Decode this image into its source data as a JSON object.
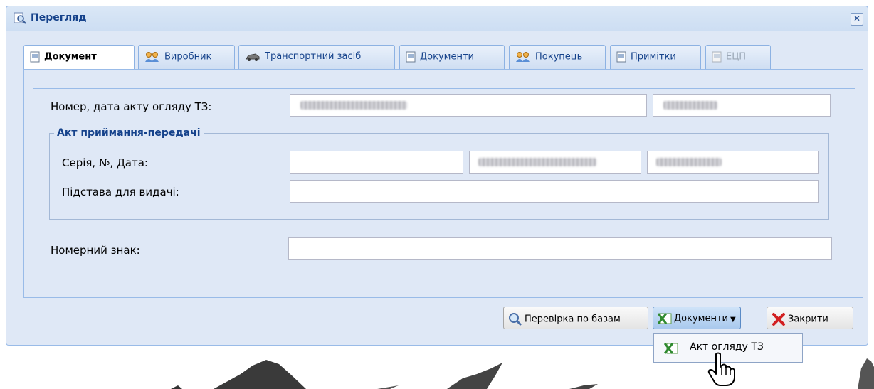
{
  "window": {
    "title": "Перегляд"
  },
  "tabs": [
    {
      "label": "Документ",
      "icon": "document-icon"
    },
    {
      "label": "Виробник",
      "icon": "users-icon"
    },
    {
      "label": "Транспортний засіб",
      "icon": "car-icon"
    },
    {
      "label": "Документи",
      "icon": "document-icon"
    },
    {
      "label": "Покупець",
      "icon": "users-icon"
    },
    {
      "label": "Примітки",
      "icon": "document-icon"
    },
    {
      "label": "ЕЦП",
      "icon": "document-icon"
    }
  ],
  "form": {
    "inspection_label": "Номер, дата акту огляду ТЗ:",
    "group_legend": "Акт приймання-передачі",
    "series_label": "Серія, №, Дата:",
    "basis_label": "Підстава для видачі:",
    "plate_label": "Номерний знак:"
  },
  "buttons": {
    "check": "Перевірка по базам",
    "documents": "Документи",
    "close": "Закрити"
  },
  "menu": {
    "items": [
      {
        "label": "Акт огляду ТЗ"
      }
    ]
  },
  "colors": {
    "accent": "#15428b",
    "window_bg": "#dfe8f6",
    "border": "#99bbe8"
  }
}
